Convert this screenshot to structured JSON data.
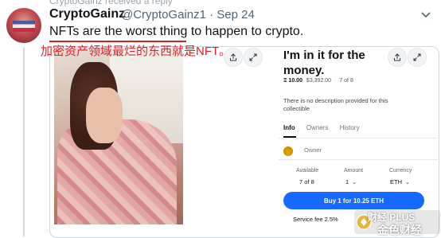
{
  "thread": {
    "reply_notice": "CryptoGainz received a reply"
  },
  "tweet": {
    "display_name": "CryptoGainz",
    "handle": "@CryptoGainz1",
    "separator": "·",
    "date": "Sep 24",
    "text": "NFTs are the worst thing to happen to crypto.",
    "translation": "加密资产领域最烂的东西就是NFT。",
    "underline_color": "#d62020"
  },
  "nft_card": {
    "title": "I'm in it for the money.",
    "price_eth": "Ξ 10.00",
    "price_usd": "$3,392.00",
    "edition": "7 of 8",
    "description": "There is no description provided for this collectible",
    "tabs": [
      "Info",
      "Owners",
      "History"
    ],
    "active_tab": "Info",
    "owner_label": "Owner",
    "available_label": "Available",
    "available_value": "7 of 8",
    "amount_label": "Amount",
    "amount_value": "1",
    "currency_label": "Currency",
    "currency_value": "ETH",
    "buy_label": "Buy 1 for 10.25 ETH",
    "fee_text": "Service fee 2.5%",
    "accent_color": "#1769ff",
    "icons": [
      "share-icon",
      "expand-icon",
      "chevron-down-icon",
      "owner-avatar"
    ]
  },
  "watermark": {
    "line1": "财经 PLUS",
    "line2": "金色财经"
  }
}
